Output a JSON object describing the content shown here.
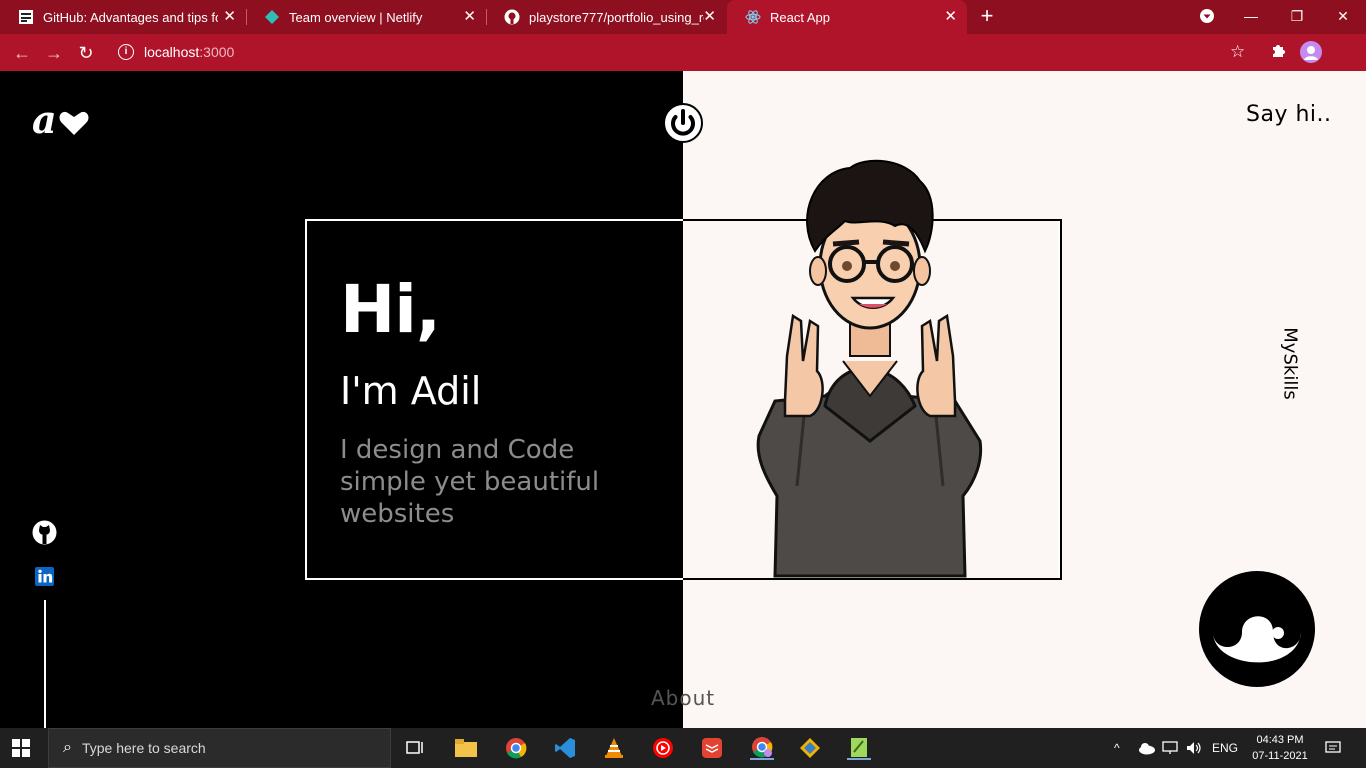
{
  "browser": {
    "tabs": [
      {
        "title": "GitHub: Advantages and tips for a"
      },
      {
        "title": "Team overview | Netlify"
      },
      {
        "title": "playstore777/portfolio_using_rea"
      },
      {
        "title": "React App"
      }
    ],
    "url_host": "localhost",
    "url_port": ":3000",
    "colors": {
      "tabbar": "#8e0f1f",
      "toolbar": "#b0142b"
    }
  },
  "page": {
    "logo_text": "a",
    "greeting": "Hi,",
    "name_line": "I'm Adil",
    "tagline": "I design and Code simple yet beautiful websites",
    "say_hi": "Say hi..",
    "my_skills": "MySkills",
    "about": "About",
    "colors": {
      "dark": "#000000",
      "light": "#fcf6f4",
      "muted_text": "#8c8c8c"
    }
  },
  "taskbar": {
    "search_placeholder": "Type here to search",
    "language": "ENG",
    "time": "04:43 PM",
    "date": "07-11-2021"
  }
}
